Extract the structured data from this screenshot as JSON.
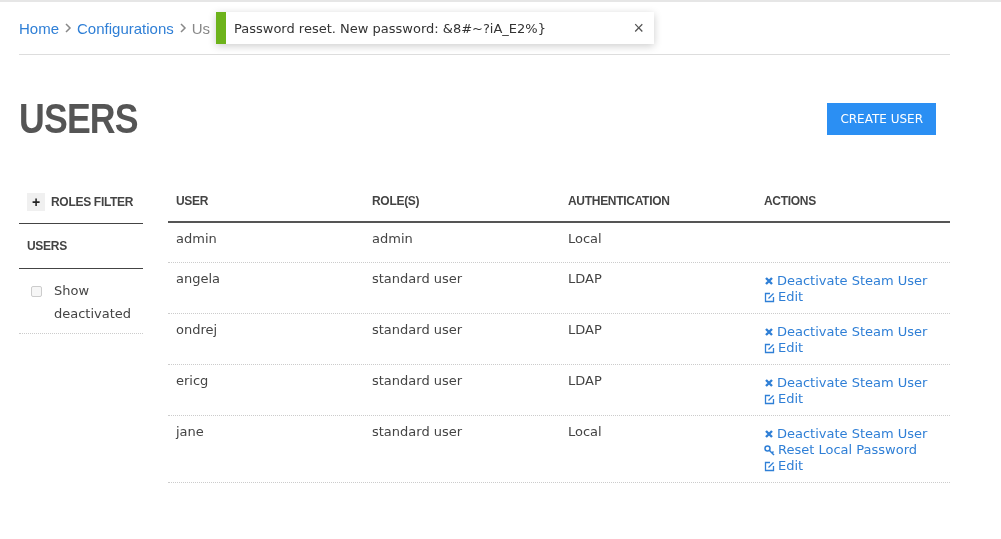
{
  "breadcrumb": [
    {
      "label": "Home",
      "kind": "link"
    },
    {
      "label": "Configurations",
      "kind": "link"
    },
    {
      "label": "Us",
      "kind": "current"
    }
  ],
  "toast": {
    "message": "Password reset. New password: &8#~?iA_E2%}",
    "close": "×"
  },
  "title": "USERS",
  "create_button": "CREATE USER",
  "sidebar": {
    "roles_filter": {
      "icon": "+",
      "label": "ROLES FILTER"
    },
    "users_heading": "USERS",
    "show_deactivated": {
      "label": "Show deactivated",
      "checked": false
    }
  },
  "table": {
    "columns": [
      "USER",
      "ROLE(S)",
      "AUTHENTICATION",
      "ACTIONS"
    ],
    "rows": [
      {
        "user": "admin",
        "roles": "admin",
        "auth": "Local",
        "actions": []
      },
      {
        "user": "angela",
        "roles": "standard user",
        "auth": "LDAP",
        "actions": [
          {
            "kind": "deactivate",
            "label": "Deactivate Steam User"
          },
          {
            "kind": "edit",
            "label": "Edit"
          }
        ]
      },
      {
        "user": "ondrej",
        "roles": "standard user",
        "auth": "LDAP",
        "actions": [
          {
            "kind": "deactivate",
            "label": "Deactivate Steam User"
          },
          {
            "kind": "edit",
            "label": "Edit"
          }
        ]
      },
      {
        "user": "ericg",
        "roles": "standard user",
        "auth": "LDAP",
        "actions": [
          {
            "kind": "deactivate",
            "label": "Deactivate Steam User"
          },
          {
            "kind": "edit",
            "label": "Edit"
          }
        ]
      },
      {
        "user": "jane",
        "roles": "standard user",
        "auth": "Local",
        "actions": [
          {
            "kind": "deactivate",
            "label": "Deactivate Steam User"
          },
          {
            "kind": "reset",
            "label": "Reset Local Password"
          },
          {
            "kind": "edit",
            "label": "Edit"
          }
        ]
      }
    ]
  }
}
